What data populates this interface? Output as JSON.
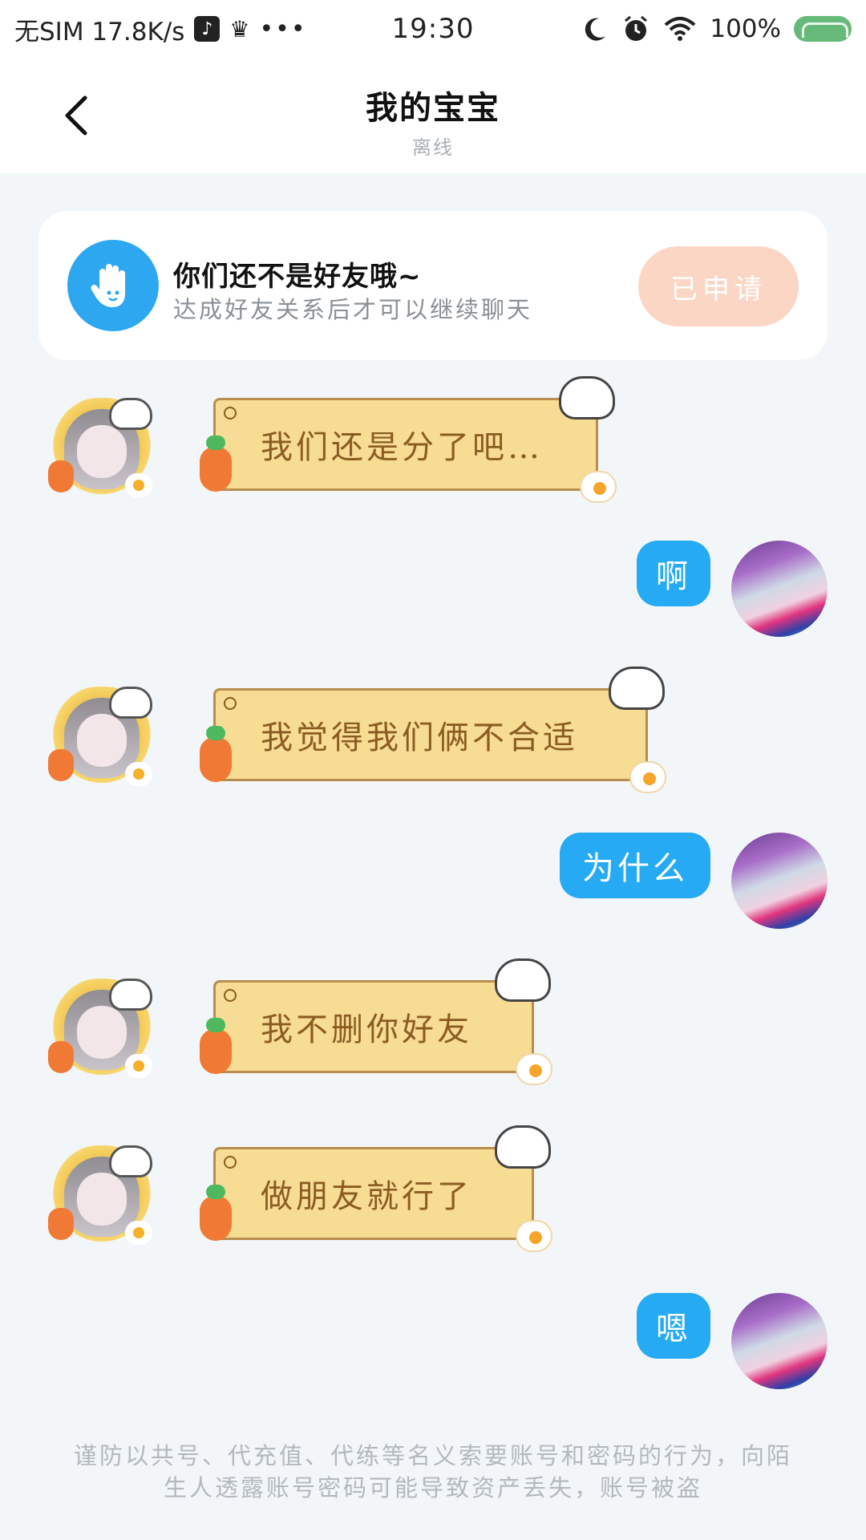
{
  "status_bar": {
    "left_text": "无SIM 17.8K/s",
    "time": "19:30",
    "battery": "100%",
    "icons": [
      "music-icon",
      "crown-icon",
      "more-dots-icon",
      "moon-icon",
      "alarm-icon",
      "wifi-icon",
      "battery-icon"
    ]
  },
  "header": {
    "title": "我的宝宝",
    "subtitle": "离线"
  },
  "notice": {
    "title": "你们还不是好友哦~",
    "description": "达成好友关系后才可以继续聊天",
    "button": "已申请",
    "icon": "wave-hand-icon"
  },
  "messages": [
    {
      "side": "left",
      "text": "我们还是分了吧…"
    },
    {
      "side": "right",
      "text": "啊"
    },
    {
      "side": "left",
      "text": "我觉得我们俩不合适"
    },
    {
      "side": "right",
      "text": "为什么"
    },
    {
      "side": "left",
      "text": "我不删你好友"
    },
    {
      "side": "left",
      "text": "做朋友就行了"
    },
    {
      "side": "right",
      "text": "嗯"
    }
  ],
  "footer_note": "谨防以共号、代充值、代练等名义索要账号和密码的行为，向陌生人透露账号密码可能导致资产丢失，账号被盗",
  "colors": {
    "accent_blue": "#26aaf4",
    "bubble_yellow": "#f7dc94",
    "bubble_text": "#8b5c22",
    "applied_button": "#fcd6c4"
  }
}
